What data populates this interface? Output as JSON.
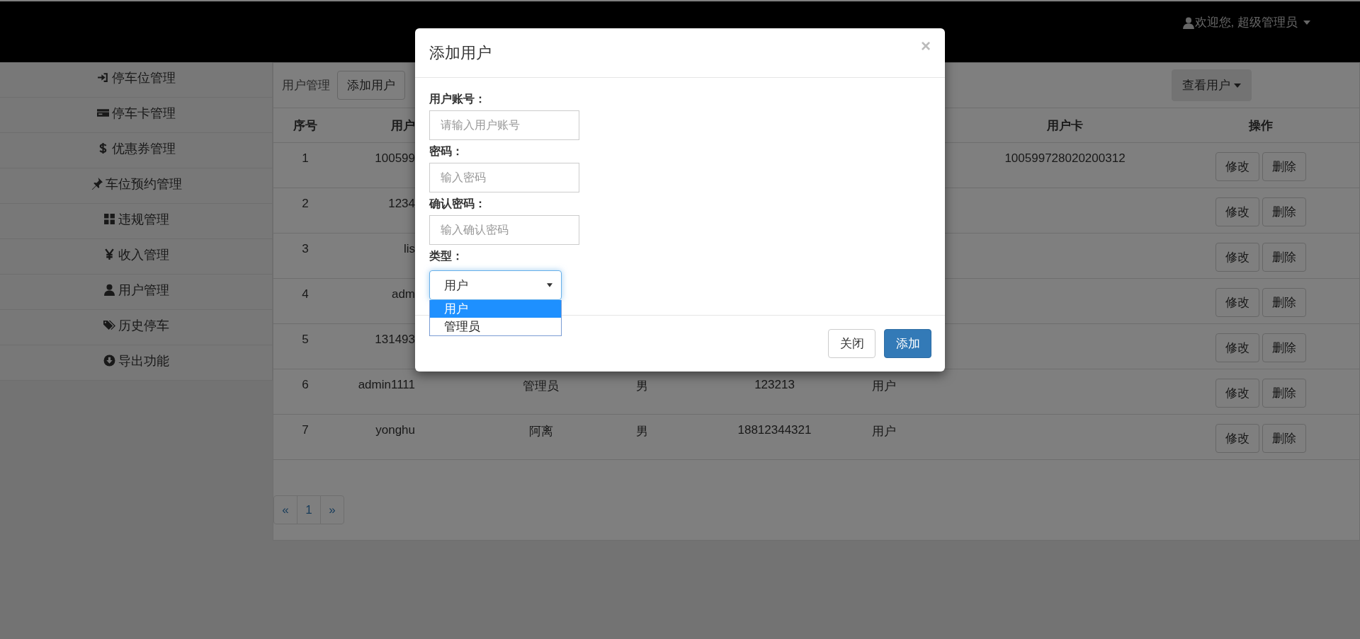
{
  "header": {
    "user_menu": "欢迎您, 超级管理员"
  },
  "sidebar": {
    "items": [
      {
        "label": "停车位管理"
      },
      {
        "label": "停车卡管理"
      },
      {
        "label": "优惠券管理"
      },
      {
        "label": "车位预约管理"
      },
      {
        "label": "违规管理"
      },
      {
        "label": "收入管理"
      },
      {
        "label": "用户管理"
      },
      {
        "label": "历史停车"
      },
      {
        "label": "导出功能"
      }
    ]
  },
  "toolbar": {
    "title": "用户管理",
    "add_button": "添加用户",
    "view_button": "查看用户"
  },
  "table": {
    "columns": [
      {
        "label": "序号"
      },
      {
        "label": "用户"
      },
      {},
      {},
      {},
      {},
      {
        "label": "用户卡"
      },
      {
        "label": "操作"
      }
    ],
    "rows": [
      {
        "no": "1",
        "account": "100599",
        "card": "100599728020200312",
        "actions": [
          "修改",
          "删除"
        ]
      },
      {
        "no": "2",
        "account": "1234",
        "actions": [
          "修改",
          "删除"
        ]
      },
      {
        "no": "3",
        "account": "lis",
        "actions": [
          "修改",
          "删除"
        ]
      },
      {
        "no": "4",
        "account": "adm",
        "actions": [
          "修改",
          "删除"
        ]
      },
      {
        "no": "5",
        "account": "131493",
        "actions": [
          "修改",
          "删除"
        ]
      },
      {
        "no": "6",
        "account": "admin1111",
        "name": "管理员",
        "gender": "男",
        "phone": "123213",
        "type": "用户",
        "actions": [
          "修改",
          "删除"
        ]
      },
      {
        "no": "7",
        "account": "yonghu",
        "name": "阿离",
        "gender": "男",
        "phone": "18812344321",
        "type": "用户",
        "actions": [
          "修改",
          "删除"
        ]
      }
    ]
  },
  "pagination": [
    {
      "label": "«"
    },
    {
      "label": "1"
    },
    {
      "label": "»"
    }
  ],
  "modal": {
    "title": "添加用户",
    "close": "×",
    "fields": [
      {
        "label": "用户账号：",
        "placeholder": "请输入用户账号"
      },
      {
        "label": "密码：",
        "placeholder": "输入密码"
      },
      {
        "label": "确认密码：",
        "placeholder": "输入确认密码"
      }
    ],
    "type_label": "类型：",
    "type_value": "用户",
    "type_options": [
      {
        "label": "用户",
        "selected": true
      },
      {
        "label": "管理员",
        "selected": false
      }
    ],
    "buttons": [
      {
        "label": "关闭",
        "kind": "default"
      },
      {
        "label": "添加",
        "kind": "primary"
      }
    ]
  }
}
